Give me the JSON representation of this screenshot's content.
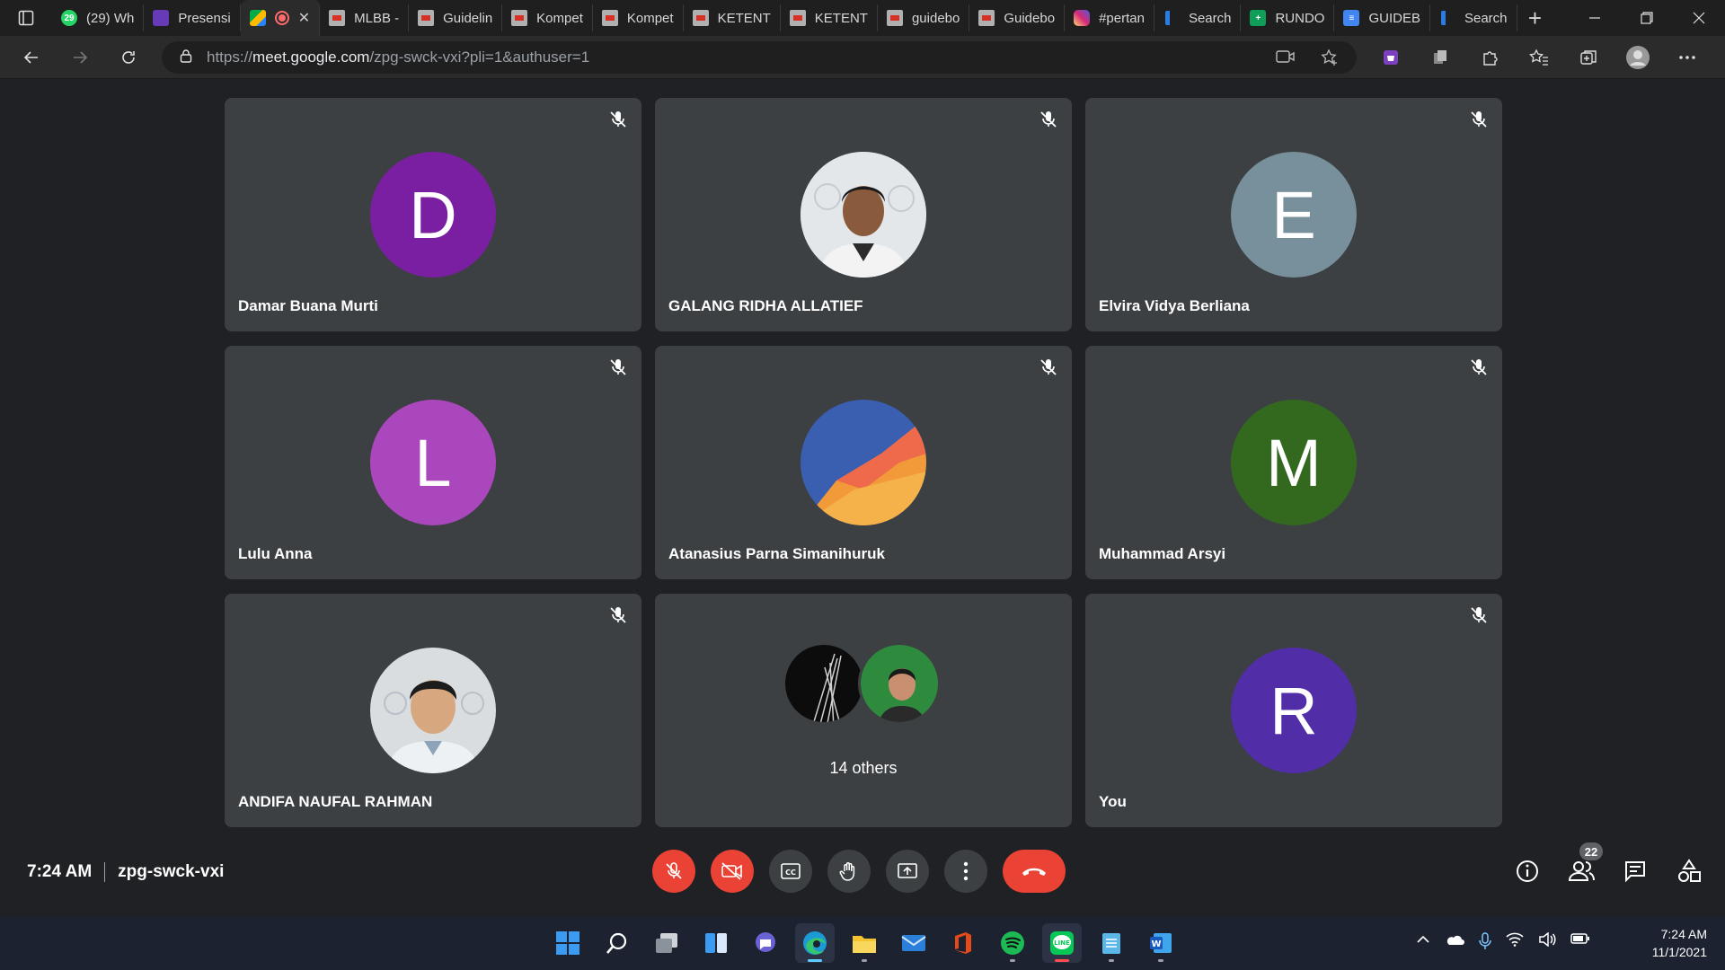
{
  "browser": {
    "tabs": [
      {
        "label": "(29) Wh",
        "icon": "whatsapp-icon",
        "badge": "29"
      },
      {
        "label": "Presensi",
        "icon": "google-forms-icon"
      },
      {
        "label": "",
        "icon": "google-meet-icon",
        "active": true
      },
      {
        "label": "MLBB -",
        "icon": "pdf-icon"
      },
      {
        "label": "Guidelin",
        "icon": "pdf-icon"
      },
      {
        "label": "Kompet",
        "icon": "pdf-icon"
      },
      {
        "label": "Kompet",
        "icon": "pdf-icon"
      },
      {
        "label": "KETENT",
        "icon": "pdf-icon"
      },
      {
        "label": "KETENT",
        "icon": "pdf-icon"
      },
      {
        "label": "guidebo",
        "icon": "pdf-icon"
      },
      {
        "label": "Guidebo",
        "icon": "pdf-icon"
      },
      {
        "label": "#pertan",
        "icon": "instagram-icon"
      },
      {
        "label": "Search",
        "icon": "bing-icon"
      },
      {
        "label": "RUNDO",
        "icon": "google-sheets-icon"
      },
      {
        "label": "GUIDEB",
        "icon": "google-docs-icon"
      },
      {
        "label": "Search",
        "icon": "bing-icon"
      }
    ],
    "url_prefix": "https://",
    "url_host": "meet.google.com",
    "url_path": "/zpg-swck-vxi?pli=1&authuser=1"
  },
  "meet": {
    "participants": [
      {
        "name": "Damar Buana Murti",
        "initial": "D",
        "color": "#7b1fa2",
        "type": "initial"
      },
      {
        "name": "GALANG RIDHA ALLATIEF",
        "initial": "",
        "color": "#cfd8dc",
        "type": "photo"
      },
      {
        "name": "Elvira Vidya Berliana",
        "initial": "E",
        "color": "#78909c",
        "type": "initial"
      },
      {
        "name": "Lulu Anna",
        "initial": "L",
        "color": "#ab47bc",
        "type": "initial"
      },
      {
        "name": "Atanasius Parna Simanihuruk",
        "initial": "",
        "color": "#3f51b5",
        "type": "photo"
      },
      {
        "name": "Muhammad Arsyi",
        "initial": "M",
        "color": "#33691e",
        "type": "initial"
      },
      {
        "name": "ANDIFA NAUFAL RAHMAN",
        "initial": "",
        "color": "#cfd8dc",
        "type": "photo"
      },
      {
        "name": "You",
        "initial": "R",
        "color": "#512da8",
        "type": "initial"
      }
    ],
    "others_label": "14 others",
    "time": "7:24 AM",
    "meeting_code": "zpg-swck-vxi",
    "people_count": "22"
  },
  "taskbar": {
    "apps": [
      "windows-start-icon",
      "search-icon",
      "task-view-icon",
      "widgets-icon",
      "chat-icon",
      "edge-icon",
      "file-explorer-icon",
      "mail-icon",
      "office-icon",
      "spotify-icon",
      "line-icon",
      "notepad-icon",
      "word-icon"
    ],
    "clock_time": "7:24 AM",
    "clock_date": "11/1/2021"
  }
}
